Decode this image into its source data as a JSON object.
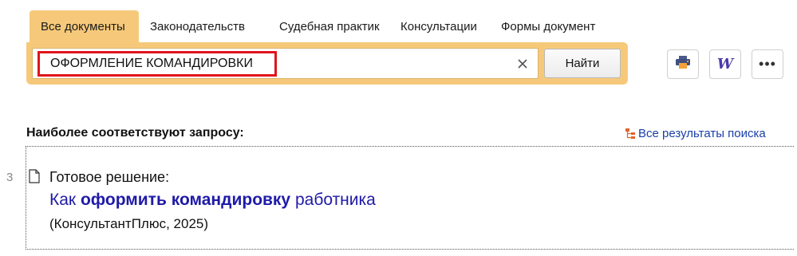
{
  "tabs": [
    {
      "label": "Все документы",
      "active": true
    },
    {
      "label": "Законодательств",
      "active": false
    },
    {
      "label": "Судебная практик",
      "active": false
    },
    {
      "label": "Консультации",
      "active": false
    },
    {
      "label": "Формы документ",
      "active": false
    }
  ],
  "search": {
    "value": "ОФОРМЛЕНИЕ КОМАНДИРОВКИ",
    "clear_icon": "close-icon",
    "find_label": "Найти"
  },
  "toolbar": {
    "icons": [
      "print-icon",
      "word-export-icon",
      "more-icon"
    ],
    "word_glyph": "W",
    "more_glyph": "•••"
  },
  "results": {
    "title": "Наиболее соответствуют запросу:",
    "all_results_label": "Все результаты поиска",
    "items": [
      {
        "number": "3",
        "label": "Готовое решение:",
        "link_parts": [
          "Как ",
          "оформить командировку",
          " работника"
        ],
        "source": "(КонсультантПлюс, 2025)"
      }
    ]
  },
  "colors": {
    "panel": "#f6c97a",
    "highlight_border": "#e0141c",
    "link": "#1f1aa8"
  }
}
